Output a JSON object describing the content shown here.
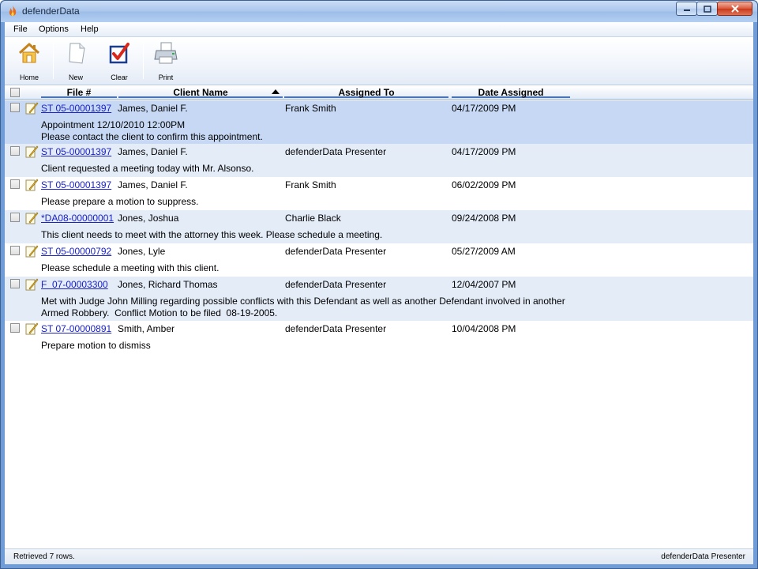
{
  "window": {
    "title": "defenderData"
  },
  "menu": {
    "file": "File",
    "options": "Options",
    "help": "Help"
  },
  "toolbar": {
    "home": "Home",
    "new": "New",
    "clear": "Clear",
    "print": "Print"
  },
  "grid": {
    "headers": {
      "file": "File #",
      "client": "Client Name",
      "assigned": "Assigned To",
      "date": "Date Assigned"
    },
    "rows": [
      {
        "file": "ST 05-00001397",
        "client": "James, Daniel F.",
        "assigned": "Frank Smith",
        "date": "04/17/2009 PM",
        "note1": "Appointment 12/10/2010 12:00PM",
        "note2": "Please contact the client to confirm this appointment."
      },
      {
        "file": "ST 05-00001397",
        "client": "James, Daniel F.",
        "assigned": "defenderData Presenter",
        "date": "04/17/2009 PM",
        "note1": "Client requested a meeting today with Mr. Alsonso.",
        "note2": ""
      },
      {
        "file": "ST 05-00001397",
        "client": "James, Daniel F.",
        "assigned": "Frank Smith",
        "date": "06/02/2009 PM",
        "note1": "Please prepare a motion to suppress.",
        "note2": ""
      },
      {
        "file": "*DA08-00000001",
        "client": "Jones, Joshua",
        "assigned": "Charlie Black",
        "date": "09/24/2008 PM",
        "note1": "This client needs to meet with the attorney this week. Please schedule a meeting.",
        "note2": ""
      },
      {
        "file": "ST 05-00000792",
        "client": "Jones, Lyle",
        "assigned": "defenderData Presenter",
        "date": "05/27/2009 AM",
        "note1": "Please schedule a meeting with this client.",
        "note2": ""
      },
      {
        "file": "F  07-00003300",
        "client": "Jones, Richard Thomas",
        "assigned": "defenderData Presenter",
        "date": "12/04/2007 PM",
        "note1": "Met with Judge John Milling regarding possible conflicts with this Defendant as well as another Defendant involved in another",
        "note2": "Armed Robbery.  Conflict Motion to be filed  08-19-2005."
      },
      {
        "file": "ST 07-00000891",
        "client": "Smith, Amber",
        "assigned": "defenderData Presenter",
        "date": "10/04/2008 PM",
        "note1": "Prepare motion to dismiss",
        "note2": ""
      }
    ]
  },
  "status": {
    "left": "Retrieved 7 rows.",
    "right": "defenderData Presenter"
  },
  "colors": {
    "selected_row": "#c6d8f4",
    "alt_row": "#e4ecf8",
    "link": "#1a22c8"
  }
}
